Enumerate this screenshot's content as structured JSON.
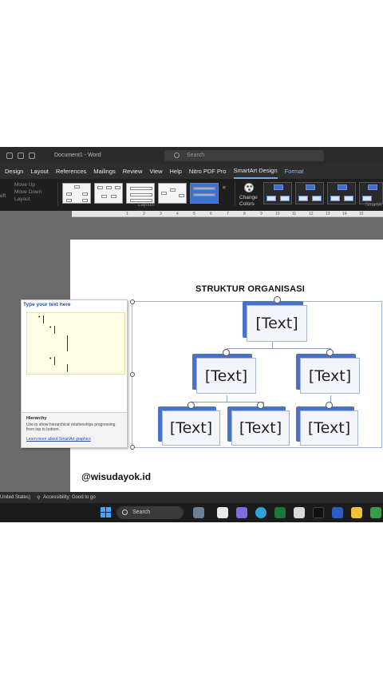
{
  "window": {
    "doc_title": "Document1 - Word",
    "search_placeholder": "Search"
  },
  "menu": {
    "tabs": [
      "Design",
      "Layout",
      "References",
      "Mailings",
      "Review",
      "View",
      "Help",
      "Nitro PDF Pro",
      "SmartArt Design",
      "Format"
    ],
    "active_tab": "SmartArt Design"
  },
  "ribbon": {
    "move_up": "Move Up",
    "move_down": "Move Down",
    "layout_label": "Layout",
    "left_fragment": "eft",
    "layouts_group": "Layouts",
    "change_colors_line1": "Change",
    "change_colors_line2": "Colors",
    "smartart_styles_fragment": "SmartA"
  },
  "ruler": {
    "ticks": [
      "1",
      "2",
      "3",
      "4",
      "5",
      "6",
      "7",
      "8",
      "9",
      "10",
      "11",
      "12",
      "13",
      "14",
      "15"
    ]
  },
  "document": {
    "heading": "STRUKTUR ORGANISASI",
    "watermark": "@wisudayok.id"
  },
  "smartart": {
    "nodes": [
      "[Text]",
      "[Text]",
      "[Text]",
      "[Text]",
      "[Text]",
      "[Text]"
    ]
  },
  "text_pane": {
    "title": "Type your text here",
    "footer_title": "Hierarchy",
    "footer_description": "Use to show hierarchical relationships progressing from top to bottom.",
    "footer_link": "Learn more about SmartArt graphics"
  },
  "status": {
    "language": "United States)",
    "accessibility": "Accessibility: Good to go"
  },
  "taskbar": {
    "search_label": "Search"
  },
  "colors": {
    "accent_blue": "#4a72c4",
    "node_fill": "#f3f5fa",
    "active_tab_underline": "#6fa8ff"
  }
}
